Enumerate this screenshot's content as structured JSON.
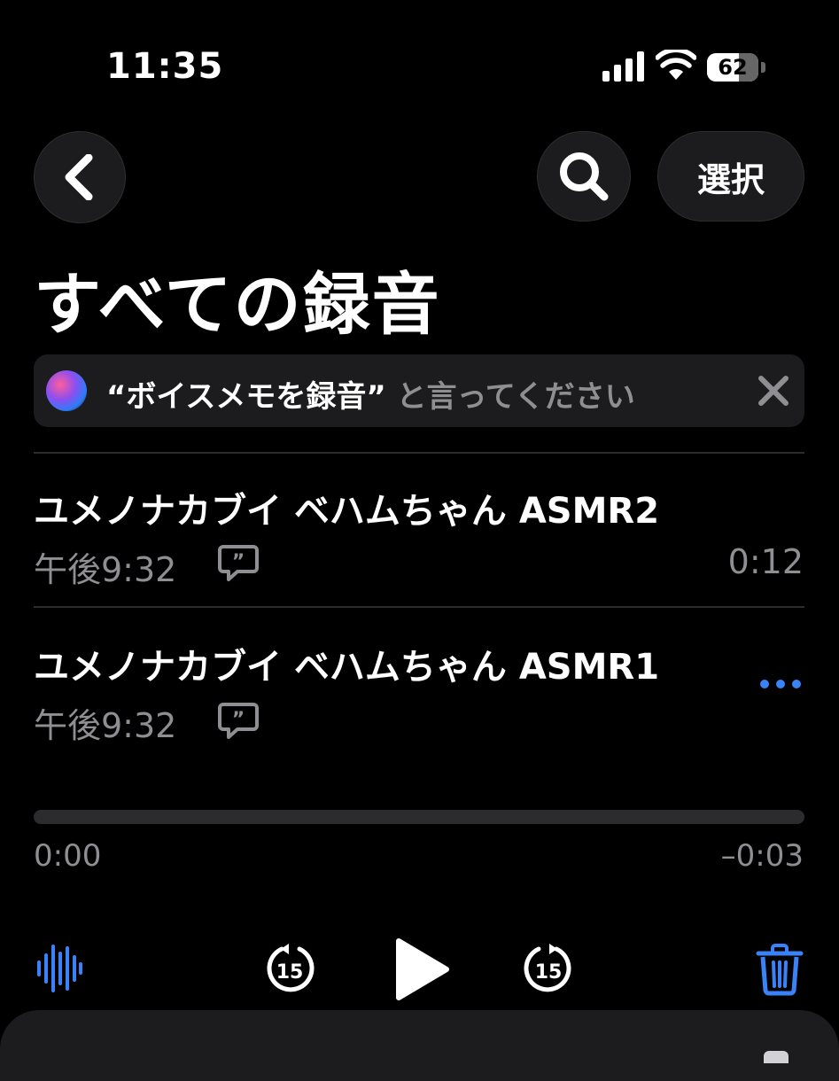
{
  "status_bar": {
    "time": "11:35",
    "battery_level": "62",
    "battery_fraction": 0.62
  },
  "nav": {
    "back_icon": "chevron-left-icon",
    "search_icon": "magnifying-glass-icon",
    "select_label": "選択"
  },
  "page_title": "すべての録音",
  "siri_banner": {
    "quote": "“ボイスメモを録音”",
    "rest": " と言ってください",
    "close_icon": "xmark-icon"
  },
  "recordings": [
    {
      "title": "ユメノナカブイ ベハムちゃん ASMR2",
      "time": "午後9:32",
      "duration": "0:12",
      "transcript_icon": "transcript-bubble-icon"
    },
    {
      "title": "ユメノナカブイ ベハムちゃん ASMR1",
      "time": "午後9:32",
      "more_icon": "ellipsis-icon",
      "transcript_icon": "transcript-bubble-icon"
    }
  ],
  "player": {
    "elapsed": "0:00",
    "remaining": "–0:03",
    "progress_fraction": 0.0,
    "skip_back_label": "15",
    "skip_forward_label": "15"
  },
  "colors": {
    "background": "#000000",
    "accent": "#3a82f7",
    "secondary_text": "#8e8e93",
    "surface": "#1c1c1e"
  }
}
